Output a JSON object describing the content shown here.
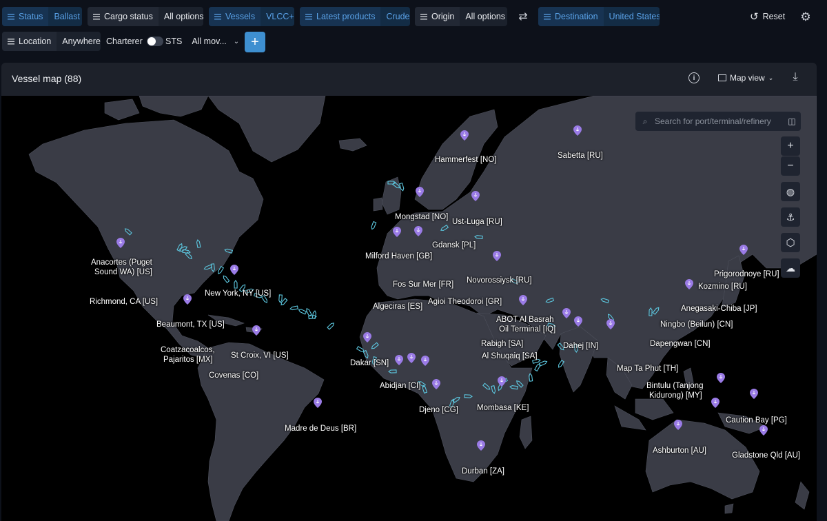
{
  "filters": {
    "status": {
      "label": "Status",
      "value": "Ballast"
    },
    "cargo_status": {
      "label": "Cargo status",
      "value": "All options"
    },
    "vessels": {
      "label": "Vessels",
      "value": "VLCC+"
    },
    "latest_products": {
      "label": "Latest products",
      "value": "Crude"
    },
    "origin": {
      "label": "Origin",
      "value": "All options"
    },
    "destination": {
      "label": "Destination",
      "value": "United States"
    },
    "location": {
      "label": "Location",
      "value": "Anywhere"
    },
    "charterer": {
      "label": "Charterer"
    },
    "sts": {
      "label": "STS",
      "value": "All mov..."
    }
  },
  "toolbar": {
    "reset_label": "Reset"
  },
  "panel": {
    "title": "Vessel map (88)",
    "view_label": "Map view"
  },
  "map": {
    "search_placeholder": "Search for port/terminal/refinery",
    "ports": [
      {
        "name": "Hammerfest [NO]"
      },
      {
        "name": "Sabetta [RU]"
      },
      {
        "name": "Mongstad [NO]"
      },
      {
        "name": "Ust-Luga [RU]"
      },
      {
        "name": "Gdansk [PL]"
      },
      {
        "name": "Milford Haven [GB]"
      },
      {
        "name": "Anacortes (Puget"
      },
      {
        "name": "Sound WA) [US]"
      },
      {
        "name": "Novorossiysk [RU]"
      },
      {
        "name": "Prigorodnoye [RU]"
      },
      {
        "name": "Fos Sur Mer [FR]"
      },
      {
        "name": "Kozmino [RU]"
      },
      {
        "name": "New York, NY [US]"
      },
      {
        "name": "Agioi Theodoroi [GR]"
      },
      {
        "name": "Richmond, CA [US]"
      },
      {
        "name": "Algeciras [ES]"
      },
      {
        "name": "Anegasaki-Chiba [JP]"
      },
      {
        "name": "ABOT Al Basrah"
      },
      {
        "name": "Oil Terminal [IQ]"
      },
      {
        "name": "Beaumont, TX [US]"
      },
      {
        "name": "Ningbo (Beilun) [CN]"
      },
      {
        "name": "Rabigh [SA]"
      },
      {
        "name": "Dahej [IN]"
      },
      {
        "name": "Dapengwan [CN]"
      },
      {
        "name": "Coatzacoalcos,"
      },
      {
        "name": "Pajaritos [MX]"
      },
      {
        "name": "St Croix, VI [US]"
      },
      {
        "name": "Al Shuqaiq [SA]"
      },
      {
        "name": "Dakar [SN]"
      },
      {
        "name": "Map Ta Phut [TH]"
      },
      {
        "name": "Covenas [CO]"
      },
      {
        "name": "Abidjan [CI]"
      },
      {
        "name": "Bintulu (Tanjong"
      },
      {
        "name": "Kidurong) [MY]"
      },
      {
        "name": "Djeno [CG]"
      },
      {
        "name": "Mombasa [KE]"
      },
      {
        "name": "Caution Bay [PG]"
      },
      {
        "name": "Madre de Deus [BR]"
      },
      {
        "name": "Ashburton [AU]"
      },
      {
        "name": "Gladstone Qld [AU]"
      },
      {
        "name": "Durban [ZA]"
      }
    ]
  }
}
